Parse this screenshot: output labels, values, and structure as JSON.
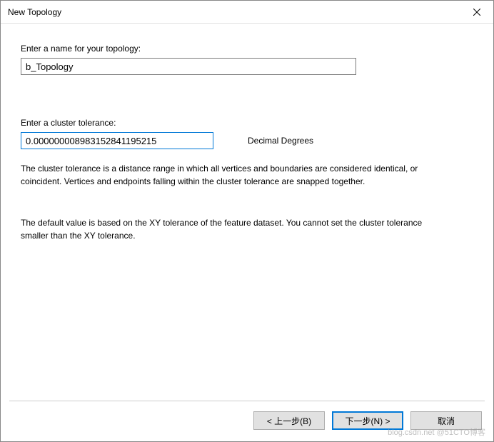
{
  "titlebar": {
    "title": "New Topology"
  },
  "form": {
    "name_label": "Enter a name for your topology:",
    "name_value": "b_Topology",
    "tolerance_label": "Enter a cluster tolerance:",
    "tolerance_value": "0.000000008983152841195215",
    "unit_label": "Decimal Degrees",
    "description1": "The cluster tolerance is a distance range in which all vertices and boundaries are considered identical, or coincident. Vertices and endpoints falling within the cluster tolerance are snapped together.",
    "description2": "The default value is based on the XY tolerance of the feature dataset. You cannot set the cluster tolerance smaller than the XY tolerance."
  },
  "buttons": {
    "back": "< 上一步(B)",
    "next": "下一步(N) >",
    "cancel": "取消"
  },
  "watermark": "blog.csdn.net @51CTO博客"
}
